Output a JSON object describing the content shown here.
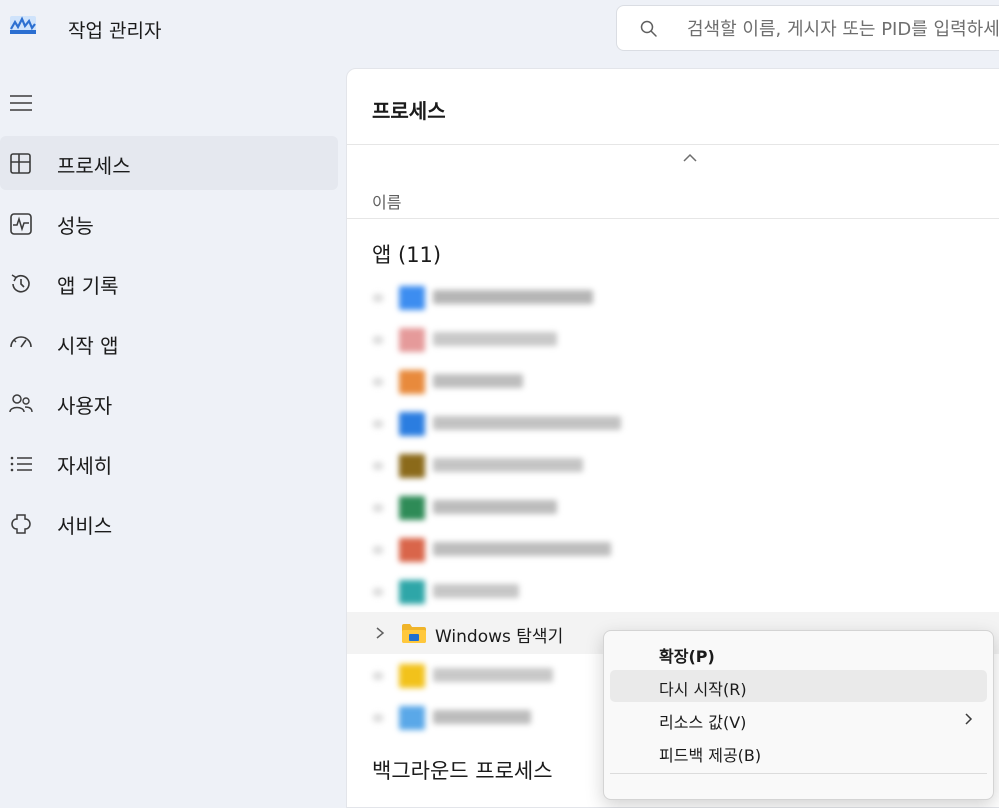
{
  "app": {
    "title": "작업 관리자",
    "icon": "task-manager-icon",
    "accent": "#3b82d6"
  },
  "search": {
    "placeholder": "검색할 이름, 게시자 또는 PID를 입력하세요",
    "value": ""
  },
  "sidebar": {
    "menu_icon": "hamburger-icon",
    "items": [
      {
        "label": "프로세스",
        "icon": "processes-icon",
        "active": true
      },
      {
        "label": "성능",
        "icon": "performance-icon",
        "active": false
      },
      {
        "label": "앱 기록",
        "icon": "app-history-icon",
        "active": false
      },
      {
        "label": "시작 앱",
        "icon": "startup-apps-icon",
        "active": false
      },
      {
        "label": "사용자",
        "icon": "users-icon",
        "active": false
      },
      {
        "label": "자세히",
        "icon": "details-icon",
        "active": false
      },
      {
        "label": "서비스",
        "icon": "services-icon",
        "active": false
      }
    ]
  },
  "main": {
    "title": "프로세스",
    "column_name": "이름",
    "apps_group": "앱 (11)",
    "background_group": "백그라운드 프로세스",
    "visible_process": "Windows 탐색기",
    "blurred_rows": [
      {
        "icon_color": "#3d8df0"
      },
      {
        "icon_color": "#e59a9a"
      },
      {
        "icon_color": "#e88a3c"
      },
      {
        "icon_color": "#2b7de0"
      },
      {
        "icon_color": "#6b4a10"
      },
      {
        "icon_color": "#2e8b57"
      },
      {
        "icon_color": "#d9654a"
      },
      {
        "icon_color": "#2ea6a8"
      },
      {
        "icon_color": "#f2c21b"
      },
      {
        "icon_color": "#5aa8e8"
      }
    ]
  },
  "context_menu": {
    "items": [
      {
        "label": "확장(P)",
        "bold": true
      },
      {
        "label": "다시 시작(R)",
        "hover": true
      },
      {
        "label": "리소스 값(V)",
        "submenu": true
      },
      {
        "label": "피드백 제공(B)"
      }
    ]
  }
}
